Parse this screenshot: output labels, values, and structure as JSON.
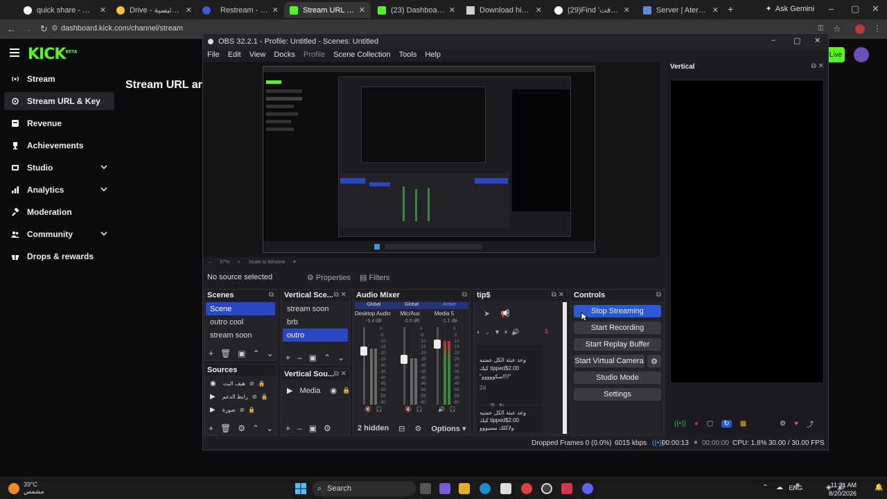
{
  "browser": {
    "tabs": [
      {
        "label": "quick share - بحث Goo",
        "color": "#ffffff"
      },
      {
        "label": "Drive - الصفحة الرئيسية",
        "color": "#f6c344"
      },
      {
        "label": "",
        "color": "#3b5bdb"
      },
      {
        "label": "Restream - هاي",
        "color": "#cfcfcf"
      },
      {
        "label": "Stream URL & Key - Ki",
        "color": "#53fc18"
      },
      {
        "label": "(23) Dashboard / Strea",
        "color": "#53fc18"
      },
      {
        "label": "Download history",
        "color": "#cfcfcf"
      },
      {
        "label": "(29)Find 'ماين كرافت'",
        "color": "#ffffff"
      },
      {
        "label": "Server | Aternos | Free",
        "color": "#5b8bd9"
      }
    ],
    "ask_gemini": "Ask Gemini",
    "url": "dashboard.kick.com/channel/stream"
  },
  "kick": {
    "logo": "KICK",
    "logo_badge": "BETA",
    "nav": [
      {
        "label": "Stream",
        "icon": "broadcast-icon",
        "expandable": false,
        "selected": false
      },
      {
        "label": "Stream URL & Key",
        "icon": "link-icon",
        "expandable": false,
        "selected": true
      },
      {
        "label": "Revenue",
        "icon": "revenue-icon",
        "expandable": false,
        "selected": false
      },
      {
        "label": "Achievements",
        "icon": "trophy-icon",
        "expandable": false,
        "selected": false
      },
      {
        "label": "Studio",
        "icon": "studio-icon",
        "expandable": true,
        "selected": false
      },
      {
        "label": "Analytics",
        "icon": "analytics-icon",
        "expandable": true,
        "selected": false
      },
      {
        "label": "Moderation",
        "icon": "gavel-icon",
        "expandable": false,
        "selected": false
      },
      {
        "label": "Community",
        "icon": "community-icon",
        "expandable": true,
        "selected": false
      },
      {
        "label": "Drops & rewards",
        "icon": "gift-icon",
        "expandable": false,
        "selected": false
      }
    ],
    "page_title": "Stream URL ar",
    "live_badge": "Live"
  },
  "obs": {
    "title": "OBS 32.2.1 - Profile: Untitled - Scenes: Untitled",
    "menu": [
      "File",
      "Edit",
      "View",
      "Docks",
      "Profile",
      "Scene Collection",
      "Tools",
      "Help"
    ],
    "zoom": "37%",
    "scale_mode": "Scale to Window",
    "no_source": "No source selected",
    "properties": "Properties",
    "filters": "Filters",
    "scenes": {
      "title": "Scenes",
      "items": [
        "Scene",
        "outro cool",
        "stream soon"
      ],
      "selected": "Scene"
    },
    "vertical_scenes": {
      "title": "Vertical Sce...",
      "items": [
        "stream soon",
        "brb",
        "outro"
      ],
      "selected": "outro"
    },
    "sources": {
      "title": "Sources",
      "items": [
        "صورة",
        "رابط الدعم",
        "هيف البث"
      ]
    },
    "vertical_sources": {
      "title": "Vertical Sou...",
      "items": [
        "Media"
      ]
    },
    "audio_mixer": {
      "title": "Audio Mixer",
      "channels": [
        {
          "name": "Desktop Audio",
          "scope": "Global",
          "db": "-5.4 dB",
          "level": 0.72
        },
        {
          "name": "Mic/Aux",
          "scope": "Global",
          "db": "-0.5 dB",
          "level": 0.6
        },
        {
          "name": "Media 5",
          "scope": "Active",
          "db": "-1.1 dB",
          "level": 0.82
        }
      ],
      "hidden": "2 hidden",
      "options": "Options",
      "scale": [
        "0",
        "-5",
        "-10",
        "-15",
        "-20",
        "-25",
        "-30",
        "-35",
        "-40",
        "-45",
        "-50",
        "-55",
        "-60"
      ]
    },
    "tips": {
      "title": "tip$",
      "entries": [
        {
          "text": "وعد عبثة الكل عمتيه\nكيك tipped$2.00\n\"سكووووو!!!!\"",
          "time": "2d"
        },
        {
          "text": "وعد عبثة الكل عمتيه\nكيك tipped$2.00\nولاكلك مسيووو",
          "time": ""
        }
      ]
    },
    "controls": {
      "title": "Controls",
      "buttons": [
        "Stop Streaming",
        "Start Recording",
        "Start Replay Buffer",
        "Start Virtual Camera",
        "Studio Mode",
        "Settings"
      ]
    },
    "vertical": {
      "title": "Vertical"
    },
    "status": {
      "dropped": "Dropped Frames 0 (0.0%)",
      "bitrate": "6015 kbps",
      "stream_time": "00:00:13",
      "rec_time": "00:00:00",
      "cpu": "CPU: 1.8%",
      "fps": "30.00 / 30.00 FPS"
    }
  },
  "taskbar": {
    "temp": "39°C",
    "weather": "مشمس",
    "search": "Search",
    "lang": "ENG",
    "time": "11:31 AM",
    "date": "8/20/2026"
  }
}
